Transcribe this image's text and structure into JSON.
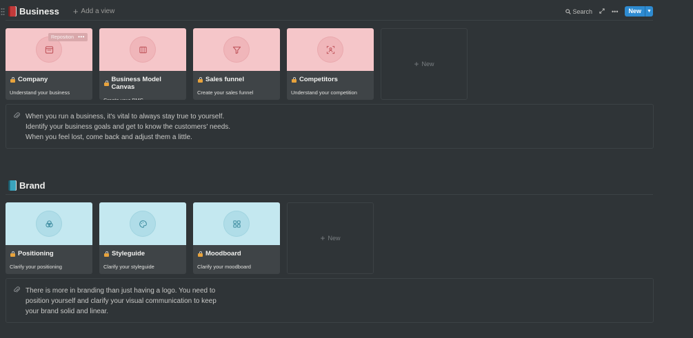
{
  "toolbar": {
    "search_label": "Search",
    "new_label": "New"
  },
  "business": {
    "title": "Business",
    "add_view_label": "Add a view",
    "overlay_label": "Reposition",
    "cards": [
      {
        "title": "Company",
        "subtitle": "Understand your business",
        "icon": "browser-window-icon"
      },
      {
        "title": "Business Model Canvas",
        "subtitle": "Create your BMC",
        "icon": "columns-icon"
      },
      {
        "title": "Sales funnel",
        "subtitle": "Create your sales funnel",
        "icon": "funnel-icon"
      },
      {
        "title": "Competitors",
        "subtitle": "Understand your competition",
        "icon": "person-scan-icon"
      }
    ],
    "new_card_label": "New",
    "callout_lines": [
      "When you run a business, it's vital to always stay true to yourself.",
      "Identify your business goals and get to know the customers' needs.",
      "When you feel lost, come back and adjust them a little."
    ]
  },
  "brand": {
    "title": "Brand",
    "cards": [
      {
        "title": "Positioning",
        "subtitle": "Clarify your positioning",
        "icon": "venn-icon"
      },
      {
        "title": "Styleguide",
        "subtitle": "Clarify your styleguide",
        "icon": "palette-icon"
      },
      {
        "title": "Moodboard",
        "subtitle": "Clarify your moodboard",
        "icon": "grid-icon"
      }
    ],
    "new_card_label": "New",
    "callout_lines": [
      "There is more in branding than just having a logo. You need to",
      "position yourself and clarify your visual communication to keep",
      "your brand solid and linear."
    ]
  },
  "colors": {
    "background": "#2f3437",
    "business_cover": "#f5c6c9",
    "brand_cover": "#c4e8f0",
    "business_icon": "#c0565d",
    "brand_icon": "#3e8da0",
    "accent_button": "#2e8bd1",
    "lock": "#e8a33c"
  }
}
